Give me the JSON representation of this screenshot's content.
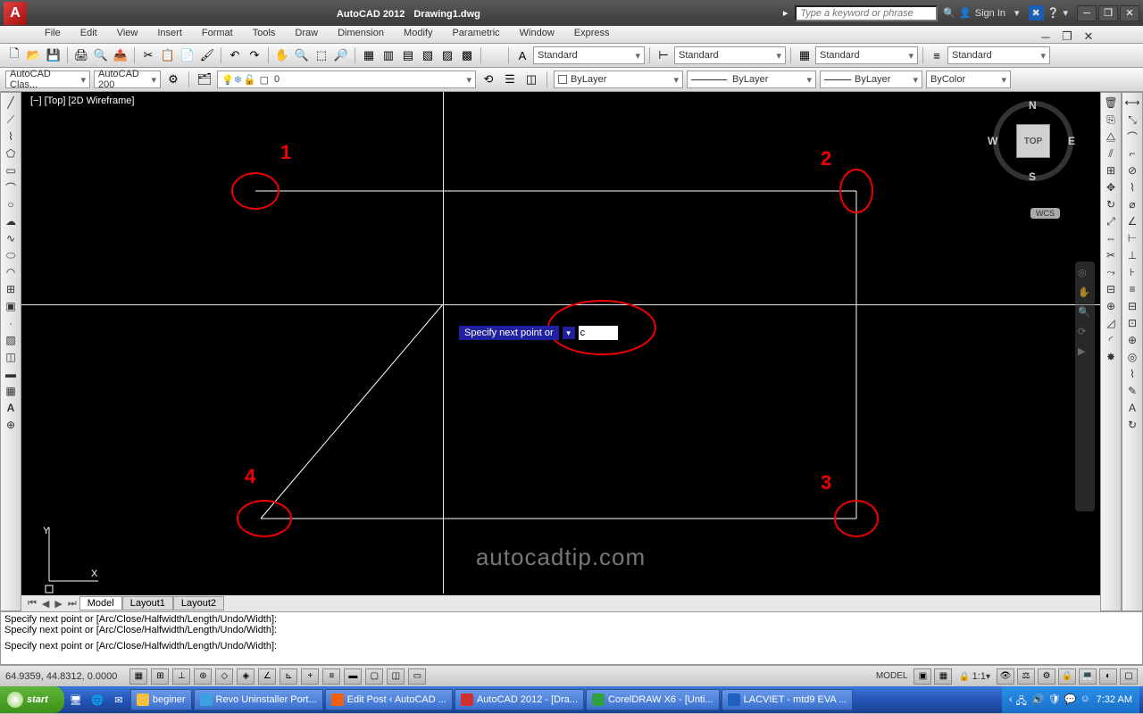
{
  "title": {
    "app": "AutoCAD 2012",
    "file": "Drawing1.dwg"
  },
  "search": {
    "placeholder": "Type a keyword or phrase",
    "signin": "Sign In"
  },
  "menu": [
    "File",
    "Edit",
    "View",
    "Insert",
    "Format",
    "Tools",
    "Draw",
    "Dimension",
    "Modify",
    "Parametric",
    "Window",
    "Express"
  ],
  "bar2": {
    "std1": "Standard",
    "std2": "Standard",
    "std3": "Standard",
    "std4": "Standard"
  },
  "panel": {
    "ws1": "AutoCAD Clas...",
    "ws2": "AutoCAD 200",
    "layer0": "0",
    "bylayer": "ByLayer",
    "bylayer2": "ByLayer",
    "bylayer3": "ByLayer",
    "bycolor": "ByColor"
  },
  "viewport": {
    "label": "[−] [Top] [2D Wireframe]"
  },
  "annotations": {
    "n1": "1",
    "n2": "2",
    "n3": "3",
    "n4": "4"
  },
  "dynamic": {
    "prompt": "Specify next point or",
    "value": "c"
  },
  "watermark": "autocadtip.com",
  "ucs": {
    "y": "Y",
    "x": "X"
  },
  "nav": {
    "top": "TOP",
    "n": "N",
    "s": "S",
    "e": "E",
    "w": "W",
    "wcs": "WCS"
  },
  "tabs": {
    "model": "Model",
    "l1": "Layout1",
    "l2": "Layout2"
  },
  "cmd": {
    "l1": "Specify next point or [Arc/Close/Halfwidth/Length/Undo/Width]:",
    "l2": "Specify next point or [Arc/Close/Halfwidth/Length/Undo/Width]:",
    "l3": "Specify next point or [Arc/Close/Halfwidth/Length/Undo/Width]:"
  },
  "status": {
    "coords": "64.9359, 44.8312, 0.0000",
    "model": "MODEL",
    "scale": "1:1"
  },
  "taskbar": {
    "start": "start",
    "tasks": [
      {
        "label": "beginer",
        "ico": "#f5c040"
      },
      {
        "label": "Revo Uninstaller Port...",
        "ico": "#3aa0e0"
      },
      {
        "label": "Edit Post ‹ AutoCAD ...",
        "ico": "#f06010"
      },
      {
        "label": "AutoCAD 2012 - [Dra...",
        "ico": "#d03030"
      },
      {
        "label": "CorelDRAW X6 - [Unti...",
        "ico": "#30a040"
      },
      {
        "label": "LACVIET - mtd9 EVA ...",
        "ico": "#2060c0"
      }
    ],
    "clock": "7:32 AM"
  }
}
